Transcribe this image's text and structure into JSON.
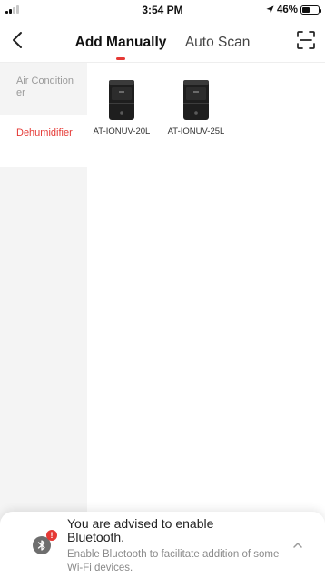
{
  "status_bar": {
    "time": "3:54 PM",
    "battery_percent": "46%",
    "battery_level": 0.46
  },
  "header": {
    "tabs": [
      {
        "label": "Add Manually",
        "active": true
      },
      {
        "label": "Auto Scan",
        "active": false
      }
    ],
    "accent_color": "#e53935"
  },
  "sidebar": {
    "categories": [
      {
        "label": "Air Conditioner",
        "active": false
      },
      {
        "label": "Dehumidifier",
        "active": true
      }
    ]
  },
  "products": [
    {
      "name": "AT-IONUV-20L",
      "icon": "dehumidifier-icon"
    },
    {
      "name": "AT-IONUV-25L",
      "icon": "dehumidifier-icon"
    }
  ],
  "bluetooth_prompt": {
    "title": "You are advised to enable Bluetooth.",
    "description": "Enable Bluetooth to facilitate addition of some Wi-Fi devices.",
    "badge": "!",
    "icon": "bluetooth-icon"
  }
}
